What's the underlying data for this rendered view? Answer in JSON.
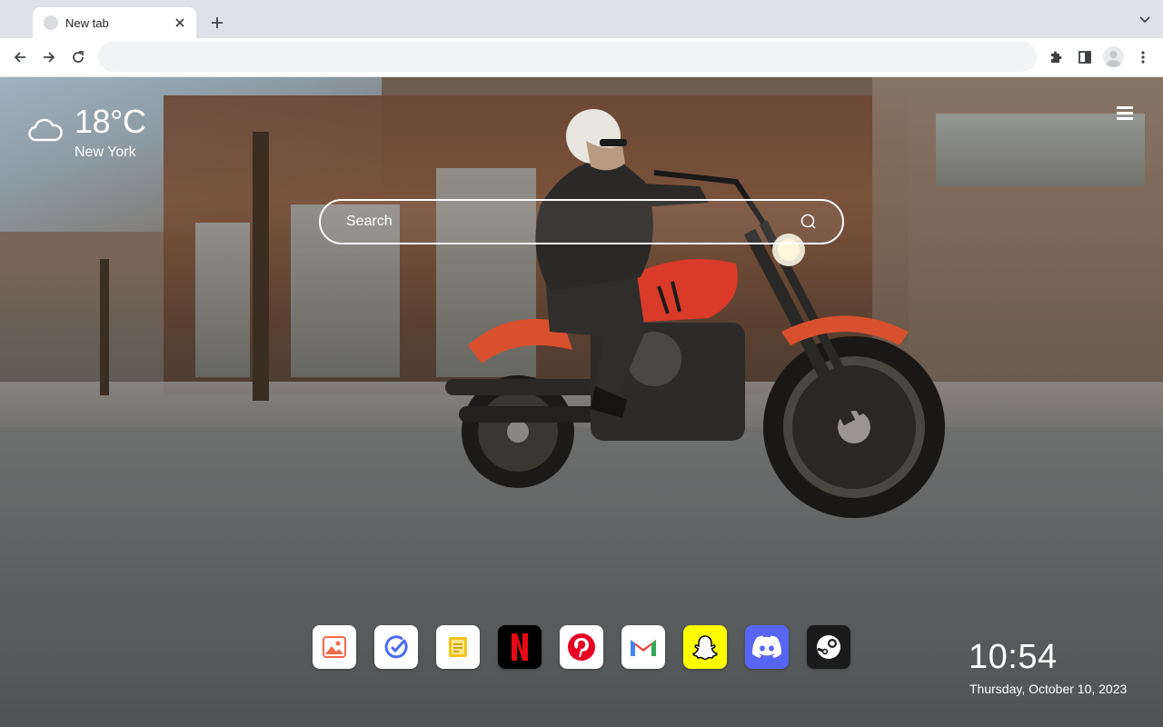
{
  "browser": {
    "tab": {
      "title": "New tab",
      "close_icon": "close-icon"
    },
    "new_tab_icon": "plus-icon",
    "tab_search_icon": "chevron-down-icon",
    "toolbar": {
      "back_icon": "arrow-left-icon",
      "forward_icon": "arrow-right-icon",
      "reload_icon": "reload-icon",
      "address_value": "",
      "extensions_icon": "puzzle-icon",
      "side_panel_icon": "side-panel-icon",
      "profile_icon": "avatar-icon",
      "menu_icon": "kebab-menu-icon"
    }
  },
  "weather": {
    "icon": "cloud-icon",
    "temperature": "18°C",
    "city": "New York"
  },
  "search": {
    "placeholder": "Search",
    "value": "",
    "icon": "search-icon"
  },
  "menu": {
    "icon": "hamburger-icon"
  },
  "dock": [
    {
      "id": "photos",
      "icon": "image-icon",
      "bg": "#ffffff",
      "color": "#f26a4b"
    },
    {
      "id": "tasks",
      "icon": "check-circle-icon",
      "bg": "#ffffff",
      "color": "#4a6cf7"
    },
    {
      "id": "notes",
      "icon": "note-icon",
      "bg": "#ffffff",
      "color": "#f4c21b"
    },
    {
      "id": "netflix",
      "icon": "netflix-icon",
      "bg": "#000000",
      "color": "#e50914"
    },
    {
      "id": "pinterest",
      "icon": "pinterest-icon",
      "bg": "#ffffff",
      "color": "#e60023"
    },
    {
      "id": "gmail",
      "icon": "gmail-icon",
      "bg": "#ffffff",
      "color": "#ea4335"
    },
    {
      "id": "snapchat",
      "icon": "snapchat-icon",
      "bg": "#fffc00",
      "color": "#ffffff"
    },
    {
      "id": "discord",
      "icon": "discord-icon",
      "bg": "#5865f2",
      "color": "#ffffff"
    },
    {
      "id": "steam",
      "icon": "steam-icon",
      "bg": "#1b1b1b",
      "color": "#ffffff"
    }
  ],
  "clock": {
    "time": "10:54",
    "date": "Thursday, October 10, 2023"
  }
}
